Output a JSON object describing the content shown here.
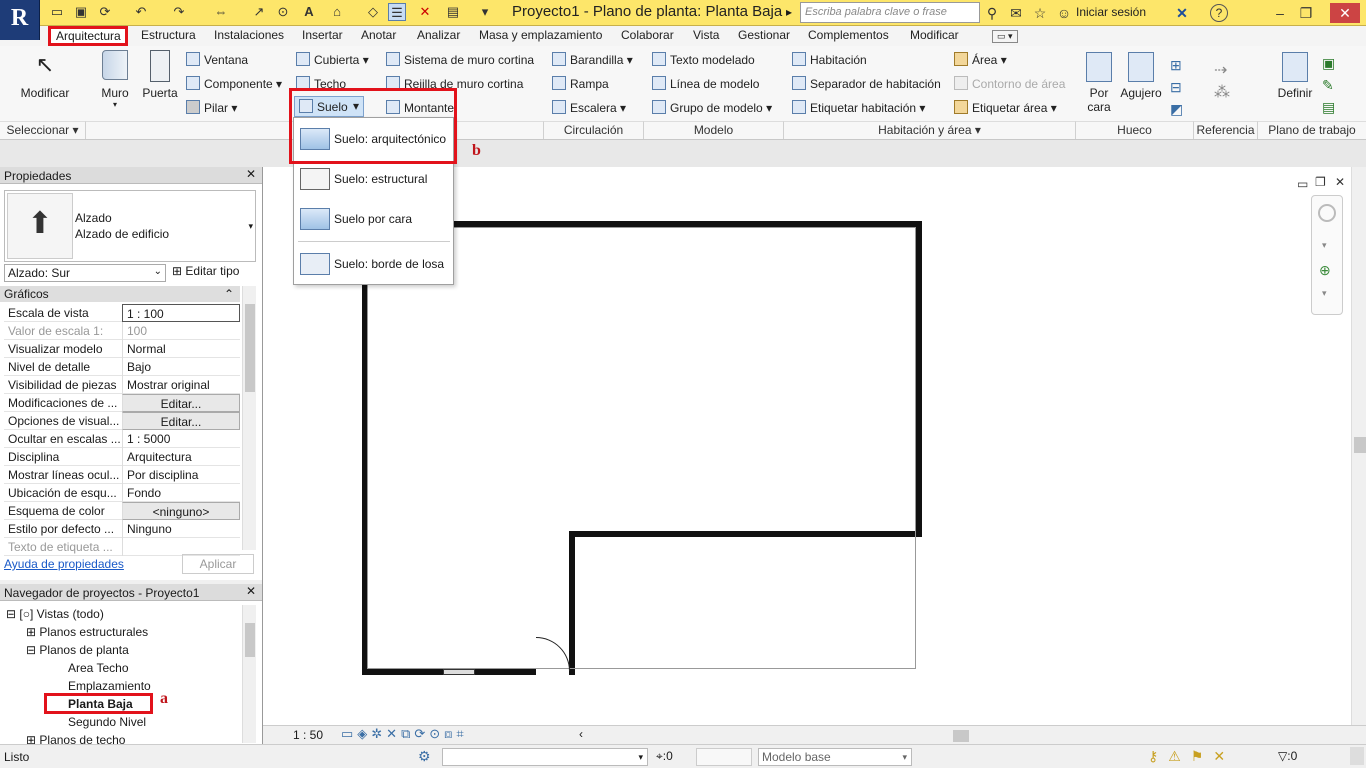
{
  "app": {
    "logo_letter": "R",
    "title": "Proyecto1 - Plano de planta: Planta Baja",
    "search_placeholder": "Escriba palabra clave o frase",
    "signin": "Iniciar sesión"
  },
  "menu": [
    "Arquitectura",
    "Estructura",
    "Instalaciones",
    "Insertar",
    "Anotar",
    "Analizar",
    "Masa y emplazamiento",
    "Colaborar",
    "Vista",
    "Gestionar",
    "Complementos",
    "Modificar"
  ],
  "ribbon": {
    "modificar": "Modificar",
    "muro": "Muro",
    "puerta": "Puerta",
    "ventana": "Ventana",
    "componente": "Componente",
    "pilar": "Pilar",
    "cubierta": "Cubierta",
    "techo": "Techo",
    "suelo": "Suelo",
    "sistema_muro": "Sistema de muro cortina",
    "rejilla_muro": "Rejilla de muro cortina",
    "montante": "Montante",
    "barandilla": "Barandilla",
    "rampa": "Rampa",
    "escalera": "Escalera",
    "texto_modelado": "Texto modelado",
    "linea_modelo": "Línea de modelo",
    "grupo_modelo": "Grupo de modelo",
    "habitacion": "Habitación",
    "separador": "Separador de habitación",
    "etiquetar_hab": "Etiquetar habitación",
    "area": "Área",
    "contorno_area": "Contorno de área",
    "etiquetar_area": "Etiquetar área",
    "por_cara": "Por cara",
    "agujero": "Agujero",
    "definir": "Definir",
    "groups": {
      "seleccionar": "Seleccionar",
      "circulacion": "Circulación",
      "modelo": "Modelo",
      "habitacion_area": "Habitación y área",
      "hueco": "Hueco",
      "referencia": "Referencia",
      "plano": "Plano de trabajo"
    }
  },
  "dropdown": [
    "Suelo: arquitectónico",
    "Suelo: estructural",
    "Suelo por cara",
    "Suelo: borde de losa"
  ],
  "labels": {
    "a": "a",
    "b": "b"
  },
  "properties": {
    "title": "Propiedades",
    "type_name1": "Alzado",
    "type_name2": "Alzado de edificio",
    "selector": "Alzado: Sur",
    "edit_type": "Editar tipo",
    "section": "Gráficos",
    "rows": [
      {
        "k": "Escala de vista",
        "v": "1 : 100"
      },
      {
        "k": "Valor de escala    1:",
        "v": "100"
      },
      {
        "k": "Visualizar modelo",
        "v": "Normal"
      },
      {
        "k": "Nivel de detalle",
        "v": "Bajo"
      },
      {
        "k": "Visibilidad de piezas",
        "v": "Mostrar original"
      },
      {
        "k": "Modificaciones de ...",
        "v": "Editar..."
      },
      {
        "k": "Opciones de visual...",
        "v": "Editar..."
      },
      {
        "k": "Ocultar en escalas ...",
        "v": "1 : 5000"
      },
      {
        "k": "Disciplina",
        "v": "Arquitectura"
      },
      {
        "k": "Mostrar líneas ocul...",
        "v": "Por disciplina"
      },
      {
        "k": "Ubicación de esqu...",
        "v": "Fondo"
      },
      {
        "k": "Esquema de color",
        "v": "<ninguno>"
      },
      {
        "k": "Estilo por defecto ...",
        "v": "Ninguno"
      },
      {
        "k": "Texto de etiqueta ...",
        "v": ""
      }
    ],
    "help": "Ayuda de propiedades",
    "apply": "Aplicar"
  },
  "navigator": {
    "title": "Navegador de proyectos - Proyecto1",
    "items": [
      "Vistas (todo)",
      "Planos estructurales",
      "Planos de planta",
      "Area Techo",
      "Emplazamiento",
      "Planta Baja",
      "Segundo Nivel",
      "Planos de techo"
    ]
  },
  "viewbar": {
    "scale": "1 : 50"
  },
  "status": {
    "text": "Listo",
    "counter": ":0",
    "model": "Modelo base",
    "filter": ":0"
  }
}
